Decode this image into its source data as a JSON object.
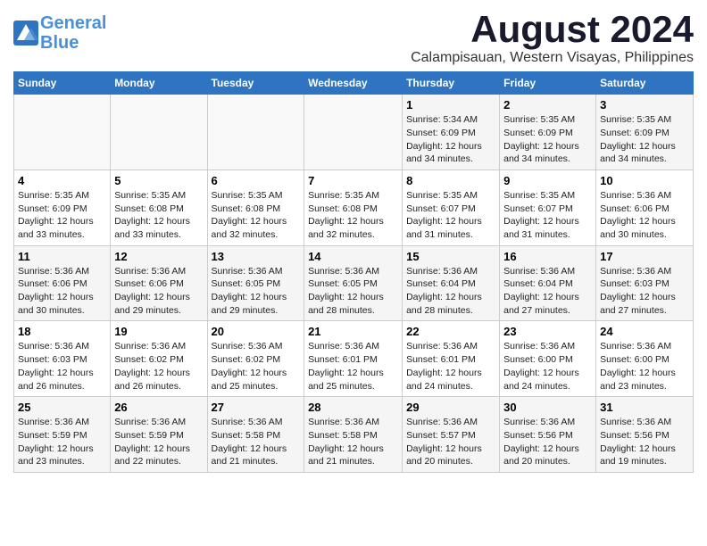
{
  "logo": {
    "line1": "General",
    "line2": "Blue"
  },
  "title": "August 2024",
  "subtitle": "Calampisauan, Western Visayas, Philippines",
  "days_of_week": [
    "Sunday",
    "Monday",
    "Tuesday",
    "Wednesday",
    "Thursday",
    "Friday",
    "Saturday"
  ],
  "weeks": [
    [
      {
        "day": "",
        "info": ""
      },
      {
        "day": "",
        "info": ""
      },
      {
        "day": "",
        "info": ""
      },
      {
        "day": "",
        "info": ""
      },
      {
        "day": "1",
        "info": "Sunrise: 5:34 AM\nSunset: 6:09 PM\nDaylight: 12 hours\nand 34 minutes."
      },
      {
        "day": "2",
        "info": "Sunrise: 5:35 AM\nSunset: 6:09 PM\nDaylight: 12 hours\nand 34 minutes."
      },
      {
        "day": "3",
        "info": "Sunrise: 5:35 AM\nSunset: 6:09 PM\nDaylight: 12 hours\nand 34 minutes."
      }
    ],
    [
      {
        "day": "4",
        "info": "Sunrise: 5:35 AM\nSunset: 6:09 PM\nDaylight: 12 hours\nand 33 minutes."
      },
      {
        "day": "5",
        "info": "Sunrise: 5:35 AM\nSunset: 6:08 PM\nDaylight: 12 hours\nand 33 minutes."
      },
      {
        "day": "6",
        "info": "Sunrise: 5:35 AM\nSunset: 6:08 PM\nDaylight: 12 hours\nand 32 minutes."
      },
      {
        "day": "7",
        "info": "Sunrise: 5:35 AM\nSunset: 6:08 PM\nDaylight: 12 hours\nand 32 minutes."
      },
      {
        "day": "8",
        "info": "Sunrise: 5:35 AM\nSunset: 6:07 PM\nDaylight: 12 hours\nand 31 minutes."
      },
      {
        "day": "9",
        "info": "Sunrise: 5:35 AM\nSunset: 6:07 PM\nDaylight: 12 hours\nand 31 minutes."
      },
      {
        "day": "10",
        "info": "Sunrise: 5:36 AM\nSunset: 6:06 PM\nDaylight: 12 hours\nand 30 minutes."
      }
    ],
    [
      {
        "day": "11",
        "info": "Sunrise: 5:36 AM\nSunset: 6:06 PM\nDaylight: 12 hours\nand 30 minutes."
      },
      {
        "day": "12",
        "info": "Sunrise: 5:36 AM\nSunset: 6:06 PM\nDaylight: 12 hours\nand 29 minutes."
      },
      {
        "day": "13",
        "info": "Sunrise: 5:36 AM\nSunset: 6:05 PM\nDaylight: 12 hours\nand 29 minutes."
      },
      {
        "day": "14",
        "info": "Sunrise: 5:36 AM\nSunset: 6:05 PM\nDaylight: 12 hours\nand 28 minutes."
      },
      {
        "day": "15",
        "info": "Sunrise: 5:36 AM\nSunset: 6:04 PM\nDaylight: 12 hours\nand 28 minutes."
      },
      {
        "day": "16",
        "info": "Sunrise: 5:36 AM\nSunset: 6:04 PM\nDaylight: 12 hours\nand 27 minutes."
      },
      {
        "day": "17",
        "info": "Sunrise: 5:36 AM\nSunset: 6:03 PM\nDaylight: 12 hours\nand 27 minutes."
      }
    ],
    [
      {
        "day": "18",
        "info": "Sunrise: 5:36 AM\nSunset: 6:03 PM\nDaylight: 12 hours\nand 26 minutes."
      },
      {
        "day": "19",
        "info": "Sunrise: 5:36 AM\nSunset: 6:02 PM\nDaylight: 12 hours\nand 26 minutes."
      },
      {
        "day": "20",
        "info": "Sunrise: 5:36 AM\nSunset: 6:02 PM\nDaylight: 12 hours\nand 25 minutes."
      },
      {
        "day": "21",
        "info": "Sunrise: 5:36 AM\nSunset: 6:01 PM\nDaylight: 12 hours\nand 25 minutes."
      },
      {
        "day": "22",
        "info": "Sunrise: 5:36 AM\nSunset: 6:01 PM\nDaylight: 12 hours\nand 24 minutes."
      },
      {
        "day": "23",
        "info": "Sunrise: 5:36 AM\nSunset: 6:00 PM\nDaylight: 12 hours\nand 24 minutes."
      },
      {
        "day": "24",
        "info": "Sunrise: 5:36 AM\nSunset: 6:00 PM\nDaylight: 12 hours\nand 23 minutes."
      }
    ],
    [
      {
        "day": "25",
        "info": "Sunrise: 5:36 AM\nSunset: 5:59 PM\nDaylight: 12 hours\nand 23 minutes."
      },
      {
        "day": "26",
        "info": "Sunrise: 5:36 AM\nSunset: 5:59 PM\nDaylight: 12 hours\nand 22 minutes."
      },
      {
        "day": "27",
        "info": "Sunrise: 5:36 AM\nSunset: 5:58 PM\nDaylight: 12 hours\nand 21 minutes."
      },
      {
        "day": "28",
        "info": "Sunrise: 5:36 AM\nSunset: 5:58 PM\nDaylight: 12 hours\nand 21 minutes."
      },
      {
        "day": "29",
        "info": "Sunrise: 5:36 AM\nSunset: 5:57 PM\nDaylight: 12 hours\nand 20 minutes."
      },
      {
        "day": "30",
        "info": "Sunrise: 5:36 AM\nSunset: 5:56 PM\nDaylight: 12 hours\nand 20 minutes."
      },
      {
        "day": "31",
        "info": "Sunrise: 5:36 AM\nSunset: 5:56 PM\nDaylight: 12 hours\nand 19 minutes."
      }
    ]
  ]
}
